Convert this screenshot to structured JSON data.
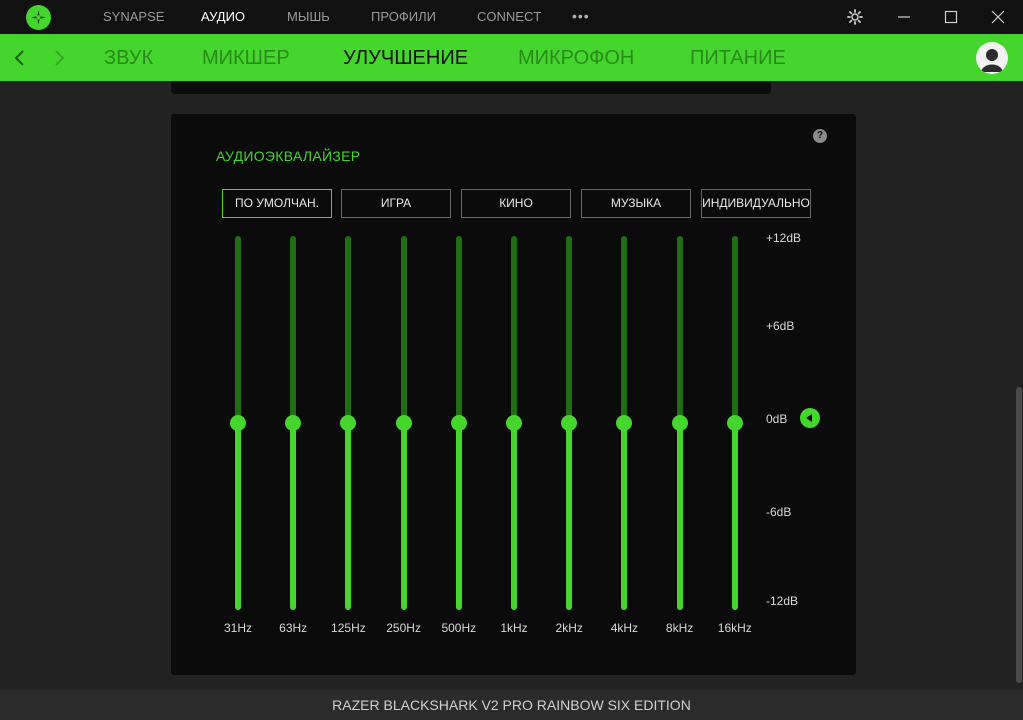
{
  "topbar": {
    "nav": [
      "SYNAPSE",
      "АУДИО",
      "МЫШЬ",
      "ПРОФИЛИ",
      "CONNECT"
    ],
    "active_index": 1,
    "more_glyph": "•••",
    "icons": [
      "razer-logo-icon",
      "settings-gear-icon",
      "minimize-icon",
      "maximize-icon",
      "close-icon"
    ]
  },
  "subnav": {
    "tabs": [
      "ЗВУК",
      "МИКШЕР",
      "УЛУЧШЕНИЕ",
      "МИКРОФОН",
      "ПИТАНИЕ"
    ],
    "active_index": 2,
    "icons": [
      "back-arrow-icon",
      "forward-arrow-icon",
      "user-avatar-icon"
    ]
  },
  "equalizer": {
    "title": "АУДИОЭКВАЛАЙЗЕР",
    "help_glyph": "?",
    "presets": [
      "ПО УМОЛЧАН.",
      "ИГРА",
      "КИНО",
      "МУЗЫКА",
      "ИНДИВИДУАЛЬНО"
    ],
    "active_preset_index": 0,
    "db_labels": [
      "+12dB",
      "+6dB",
      "0dB",
      "-6dB",
      "-12dB"
    ],
    "db_range": [
      -12,
      12
    ],
    "bands": [
      {
        "freq": "31Hz",
        "gain_db": 0
      },
      {
        "freq": "63Hz",
        "gain_db": 0
      },
      {
        "freq": "125Hz",
        "gain_db": 0
      },
      {
        "freq": "250Hz",
        "gain_db": 0
      },
      {
        "freq": "500Hz",
        "gain_db": 0
      },
      {
        "freq": "1kHz",
        "gain_db": 0
      },
      {
        "freq": "2kHz",
        "gain_db": 0
      },
      {
        "freq": "4kHz",
        "gain_db": 0
      },
      {
        "freq": "8kHz",
        "gain_db": 0
      },
      {
        "freq": "16kHz",
        "gain_db": 0
      }
    ]
  },
  "footer": {
    "device_name": "RAZER BLACKSHARK V2 PRO RAINBOW SIX EDITION"
  },
  "colors": {
    "accent": "#44d62c",
    "track_dim": "#1f6e14",
    "background": "#222222",
    "panel": "#0b0b0b"
  }
}
